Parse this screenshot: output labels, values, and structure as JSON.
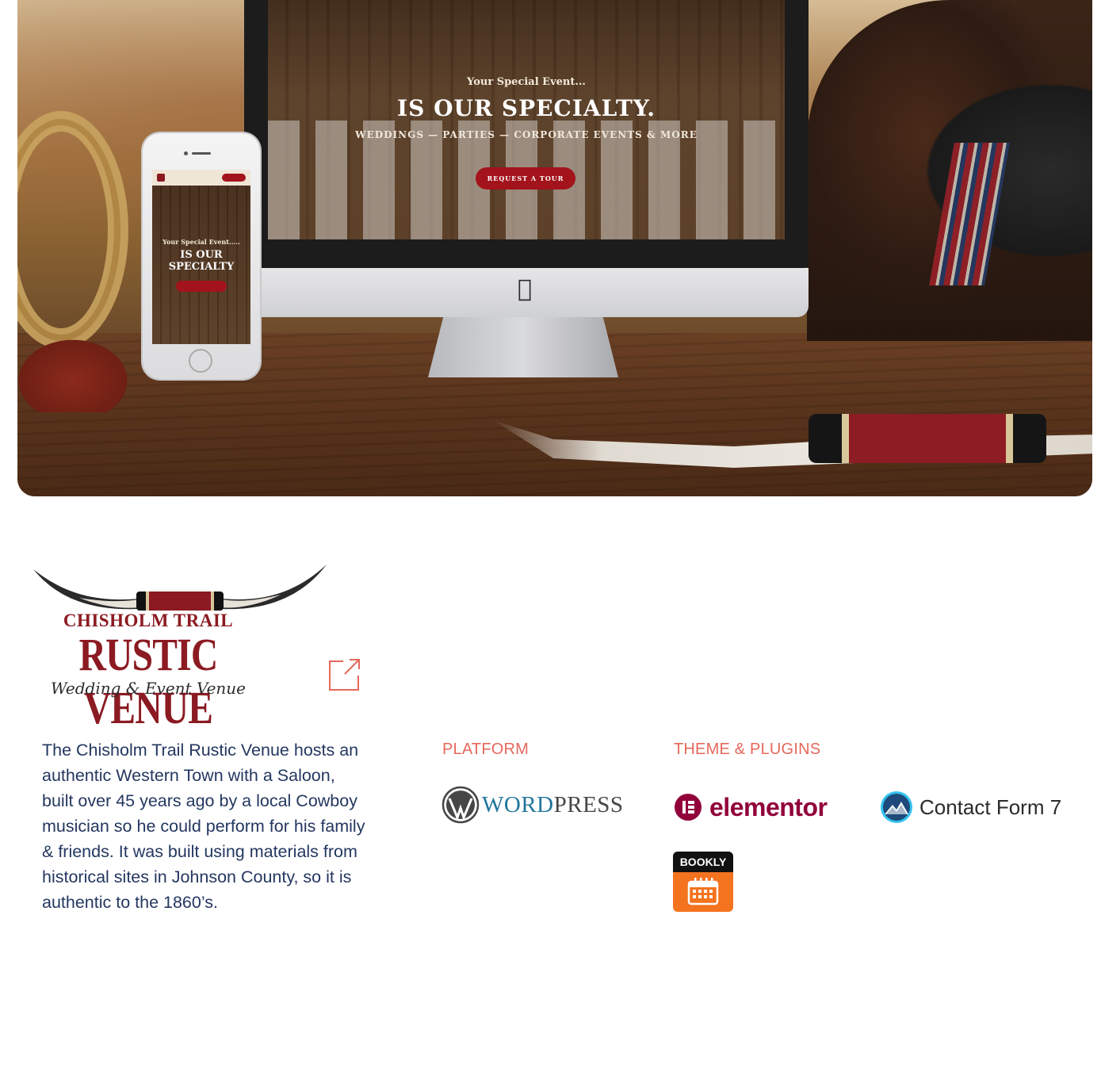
{
  "hero": {
    "screen_subtitle": "Your Special Event...",
    "screen_title": "IS OUR SPECIALTY.",
    "screen_services": "WEDDINGS — PARTIES — CORPORATE EVENTS & MORE",
    "screen_button": "REQUEST A TOUR",
    "phone_subtitle": "Your Special Event.....",
    "phone_title": "IS OUR SPECIALTY"
  },
  "brand": {
    "line1": "CHISHOLM TRAIL",
    "line2": "RUSTIC VENUE",
    "line3": "Wedding & Event Venue"
  },
  "description": "The Chisholm Trail Rustic Venue hosts an authentic Western Town with a Saloon, built over 45 years ago by a local Cowboy musician so he could perform for his family & friends. It was built using materials from historical sites in Johnson County, so it is authentic to the 1860’s.",
  "platform": {
    "label": "PLATFORM",
    "items": [
      {
        "name_part1": "WORD",
        "name_part2": "PRESS",
        "icon": "wordpress-logo-icon"
      }
    ]
  },
  "theme_plugins": {
    "label": "THEME & PLUGINS",
    "items": [
      {
        "name": "elementor",
        "icon": "elementor-logo-icon"
      },
      {
        "name": "Contact Form 7",
        "icon": "contact-form-7-logo-icon"
      },
      {
        "name": "BOOKLY",
        "icon": "bookly-calendar-icon"
      }
    ]
  },
  "colors": {
    "accent": "#e5685a",
    "text": "#243760",
    "brand_red": "#8b1a22"
  }
}
